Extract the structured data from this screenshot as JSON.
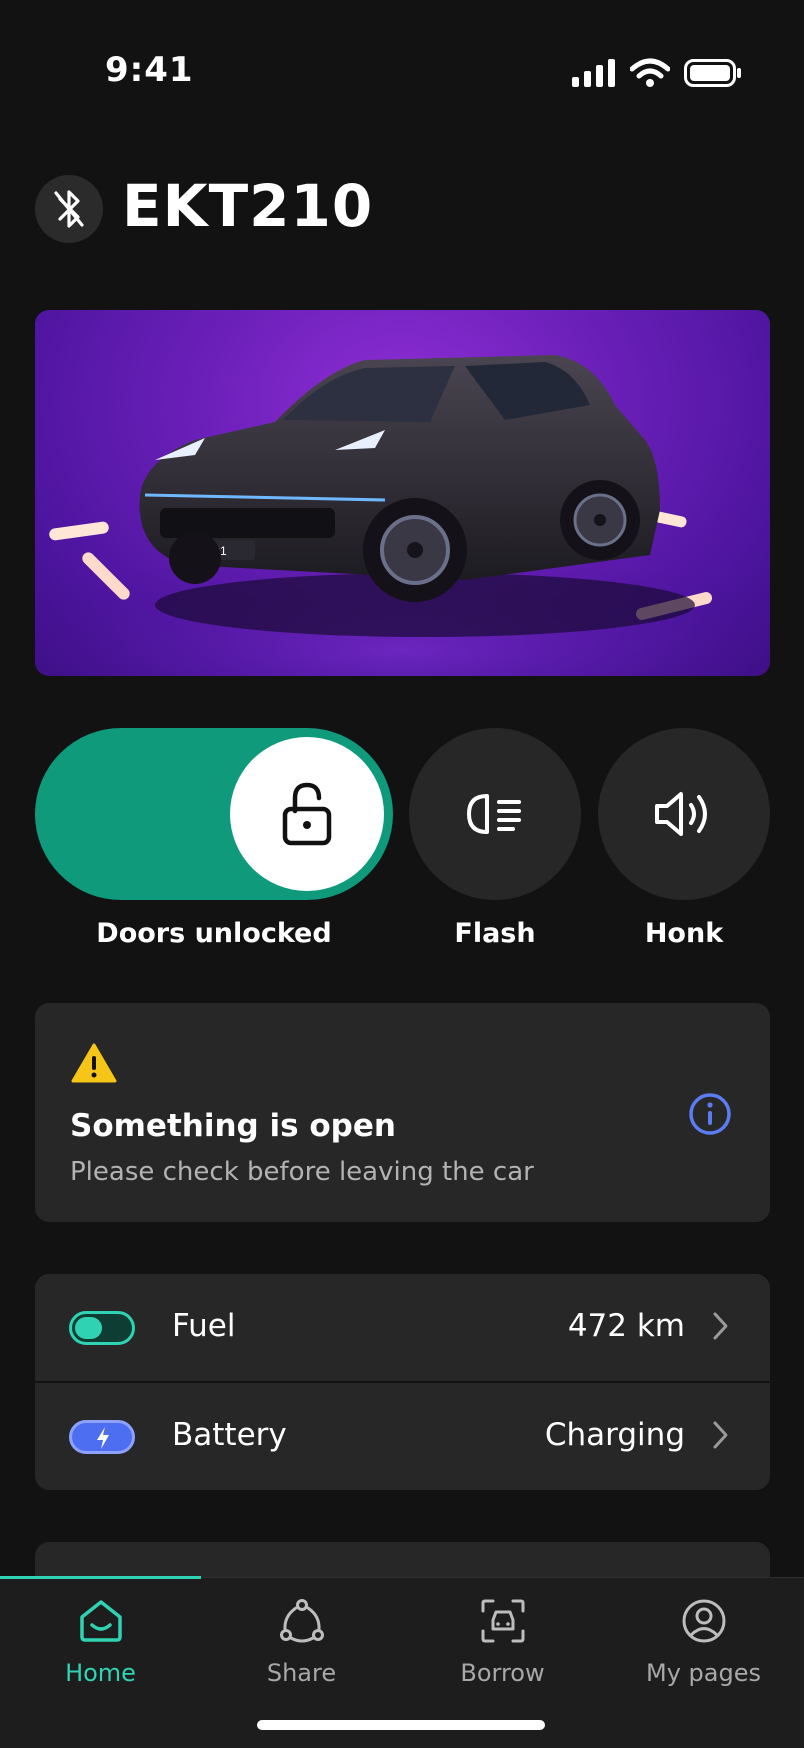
{
  "status_bar": {
    "time": "9:41"
  },
  "header": {
    "title": "EKT210",
    "bluetooth_icon": "bluetooth-off-icon"
  },
  "car_image": {
    "plate": "01"
  },
  "controls": {
    "lock": {
      "label": "Doors unlocked",
      "state": "unlocked",
      "icon": "unlocked-padlock-icon"
    },
    "flash": {
      "label": "Flash",
      "icon": "headlight-icon"
    },
    "honk": {
      "label": "Honk",
      "icon": "speaker-icon"
    }
  },
  "alert": {
    "title": "Something is open",
    "subtitle": "Please check before leaving the car",
    "warning_icon": "warning-triangle-icon",
    "info_icon": "info-icon"
  },
  "status_list": [
    {
      "label": "Fuel",
      "value": "472 km",
      "icon": "fuel-level-icon",
      "level": 0.45
    },
    {
      "label": "Battery",
      "value": "Charging",
      "icon": "battery-charging-icon"
    }
  ],
  "tabs": [
    {
      "label": "Home",
      "icon": "home-icon",
      "active": true
    },
    {
      "label": "Share",
      "icon": "share-icon",
      "active": false
    },
    {
      "label": "Borrow",
      "icon": "borrow-car-icon",
      "active": false
    },
    {
      "label": "My pages",
      "icon": "profile-icon",
      "active": false
    }
  ],
  "colors": {
    "background": "#121212",
    "card": "#272727",
    "accent_green": "#0f9a7c",
    "active_tab": "#2fd3b3",
    "warning": "#f5c518",
    "info_blue": "#5b7cf2",
    "battery_blue": "#4d6ef0"
  }
}
